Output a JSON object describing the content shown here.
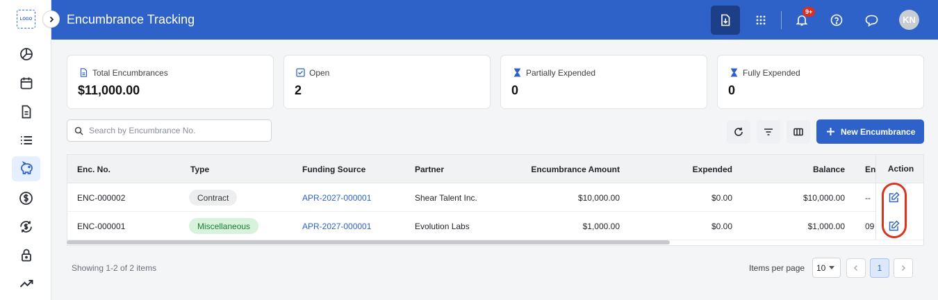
{
  "sidebar": {
    "logo_text": "LOGO",
    "items": [
      {
        "icon": "pie-chart-icon",
        "active": false
      },
      {
        "icon": "calendar-icon",
        "active": false
      },
      {
        "icon": "document-icon",
        "active": false
      },
      {
        "icon": "list-icon",
        "active": false
      },
      {
        "icon": "piggy-bank-icon",
        "active": true
      },
      {
        "icon": "dollar-circle-icon",
        "active": false
      },
      {
        "icon": "dollar-refresh-icon",
        "active": false
      },
      {
        "icon": "lock-icon",
        "active": false
      },
      {
        "icon": "trending-up-icon",
        "active": false
      }
    ]
  },
  "header": {
    "title": "Encumbrance Tracking",
    "notification_badge": "9+",
    "avatar_initials": "KN",
    "icons": [
      "download-icon",
      "apps-grid-icon",
      "bell-icon",
      "help-icon",
      "chat-icon"
    ]
  },
  "stats": [
    {
      "label": "Total Encumbrances",
      "value": "$11,000.00",
      "icon": "document-icon"
    },
    {
      "label": "Open",
      "value": "2",
      "icon": "checkbox-icon"
    },
    {
      "label": "Partially Expended",
      "value": "0",
      "icon": "hourglass-icon"
    },
    {
      "label": "Fully Expended",
      "value": "0",
      "icon": "hourglass-icon"
    }
  ],
  "search": {
    "placeholder": "Search by Encumbrance No."
  },
  "toolbar": {
    "new_label": "New Encumbrance"
  },
  "table": {
    "columns": [
      "Enc. No.",
      "Type",
      "Funding Source",
      "Partner",
      "Encumbrance Amount",
      "Expended",
      "Balance",
      "En",
      "Action"
    ],
    "rows": [
      {
        "enc_no": "ENC-000002",
        "type": "Contract",
        "funding_source": "APR-2027-000001",
        "partner": "Shear Talent Inc.",
        "amount": "$10,000.00",
        "expended": "$0.00",
        "balance": "$10,000.00",
        "extra": "--"
      },
      {
        "enc_no": "ENC-000001",
        "type": "Miscellaneous",
        "funding_source": "APR-2027-000001",
        "partner": "Evolution Labs",
        "amount": "$1,000.00",
        "expended": "$0.00",
        "balance": "$1,000.00",
        "extra": "09"
      }
    ]
  },
  "footer": {
    "showing": "Showing 1-2 of 2 items",
    "items_per_page_label": "Items per page",
    "items_per_page": "10",
    "current_page": "1"
  },
  "colors": {
    "primary": "#2f62c9",
    "highlight": "#d8351f",
    "contract_pill": "#eceef0",
    "misc_pill": "#d8f3dc"
  }
}
